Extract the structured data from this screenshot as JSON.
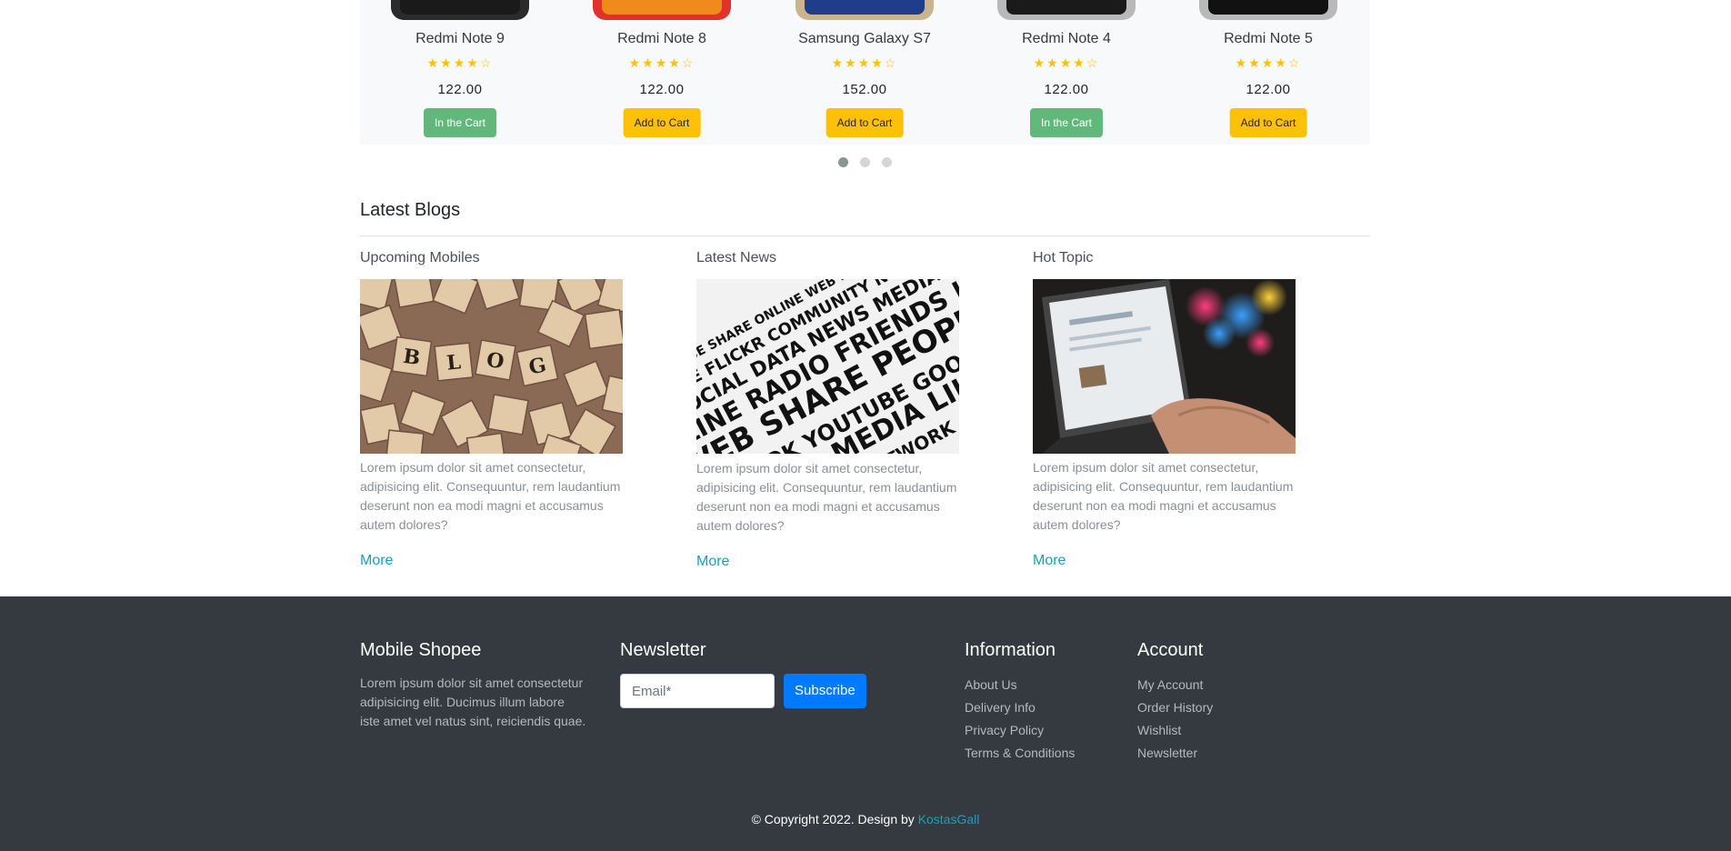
{
  "products": [
    {
      "name": "Redmi Note 9",
      "stars": "★★★★☆",
      "rating": 4,
      "price": "122.00",
      "button": "In the Cart",
      "state": "in_cart",
      "phone_color": "#2b2b2b",
      "screen_color": "#1a1a1a"
    },
    {
      "name": "Redmi Note 8",
      "stars": "★★★★☆",
      "rating": 4,
      "price": "122.00",
      "button": "Add to Cart",
      "state": "add",
      "phone_color": "#e0312b",
      "screen_color": "#f08a1c"
    },
    {
      "name": "Samsung Galaxy S7",
      "stars": "★★★★☆",
      "rating": 4,
      "price": "152.00",
      "button": "Add to Cart",
      "state": "add",
      "phone_color": "#c9b48f",
      "screen_color": "#1f3d8a"
    },
    {
      "name": "Redmi Note 4",
      "stars": "★★★★☆",
      "rating": 4,
      "price": "122.00",
      "button": "In the Cart",
      "state": "in_cart",
      "phone_color": "#b9b9b9",
      "screen_color": "#1a1a1a"
    },
    {
      "name": "Redmi Note 5",
      "stars": "★★★★☆",
      "rating": 4,
      "price": "122.00",
      "button": "Add to Cart",
      "state": "add",
      "phone_color": "#b9b9b9",
      "screen_color": "#111111"
    }
  ],
  "carousel": {
    "page_count": 3,
    "active_index": 0
  },
  "blogs": {
    "title": "Latest Blogs",
    "items": [
      {
        "title": "Upcoming Mobiles",
        "image": "blog-scrabble-tiles",
        "text": "Lorem ipsum dolor sit amet consectetur, adipisicing elit. Consequuntur, rem laudantium deserunt non ea modi magni et accusamus autem dolores?",
        "more": "More"
      },
      {
        "title": "Latest News",
        "image": "social-media-word-cloud",
        "text": "Lorem ipsum dolor sit amet consectetur, adipisicing elit. Consequuntur, rem laudantium deserunt non ea modi magni et accusamus autem dolores?",
        "more": "More"
      },
      {
        "title": "Hot Topic",
        "image": "laptop-typing",
        "text": "Lorem ipsum dolor sit amet consectetur, adipisicing elit. Consequuntur, rem laudantium deserunt non ea modi magni et accusamus autem dolores?",
        "more": "More"
      }
    ]
  },
  "footer": {
    "brand": {
      "title": "Mobile Shopee",
      "text": "Lorem ipsum dolor sit amet consectetur adipisicing elit. Ducimus illum labore iste amet vel natus sint, reiciendis quae."
    },
    "newsletter": {
      "title": "Newsletter",
      "email_placeholder": "Email*",
      "button": "Subscribe"
    },
    "information": {
      "title": "Information",
      "links": [
        "About Us",
        "Delivery Info",
        "Privacy Policy",
        "Terms & Conditions"
      ]
    },
    "account": {
      "title": "Account",
      "links": [
        "My Account",
        "Order History",
        "Wishlist",
        "Newsletter"
      ]
    },
    "copyright": {
      "text": "© Copyright 2022. Design by ",
      "author": "KostasGall"
    }
  },
  "colors": {
    "accent": "#ffc107",
    "in_cart": "#62b87a",
    "link": "#17a2b8",
    "primary": "#007bff",
    "footer_bg": "#343a40"
  }
}
